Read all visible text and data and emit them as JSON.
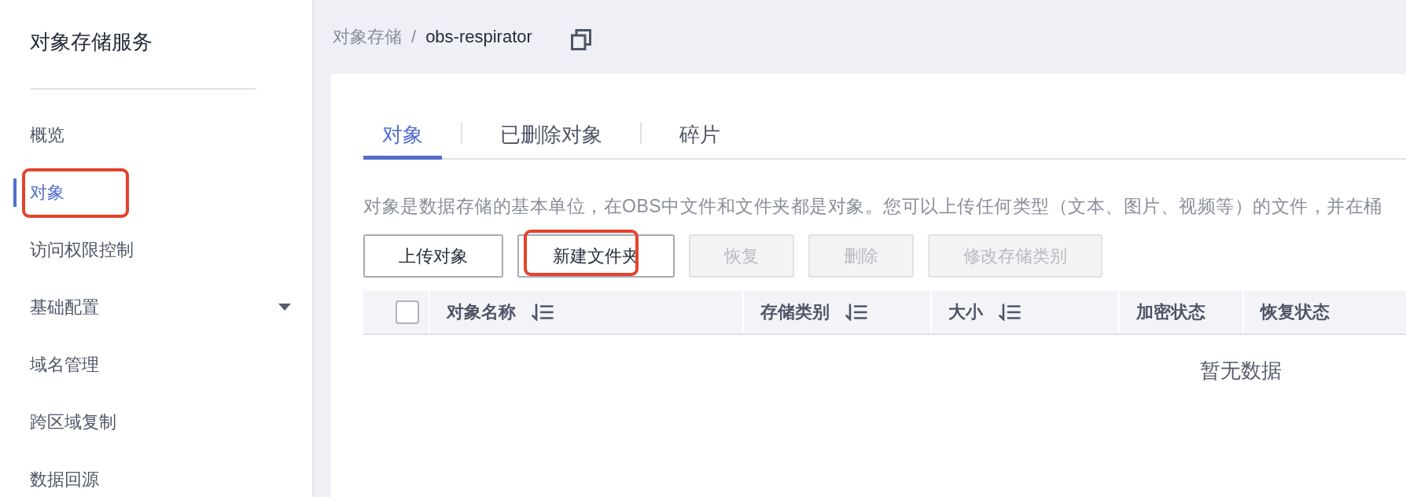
{
  "sidebar": {
    "title": "对象存储服务",
    "items": [
      {
        "label": "概览",
        "kind": "link",
        "selected": false,
        "annotated": false
      },
      {
        "label": "对象",
        "kind": "link",
        "selected": true,
        "annotated": true
      },
      {
        "label": "访问权限控制",
        "kind": "link",
        "selected": false,
        "annotated": false
      },
      {
        "label": "基础配置",
        "kind": "group",
        "selected": false,
        "annotated": false
      },
      {
        "label": "域名管理",
        "kind": "link",
        "selected": false,
        "annotated": false
      },
      {
        "label": "跨区域复制",
        "kind": "link",
        "selected": false,
        "annotated": false
      },
      {
        "label": "数据回源",
        "kind": "link",
        "selected": false,
        "annotated": false
      }
    ]
  },
  "breadcrumb": {
    "parent": "对象存储",
    "separator": "/",
    "current": "obs-respirator"
  },
  "tabs": [
    {
      "label": "对象",
      "selected": true
    },
    {
      "label": "已删除对象",
      "selected": false
    },
    {
      "label": "碎片",
      "selected": false
    }
  ],
  "description": "对象是数据存储的基本单位，在OBS中文件和文件夹都是对象。您可以上传任何类型（文本、图片、视频等）的文件，并在桶",
  "buttons": [
    {
      "label": "上传对象",
      "disabled": false,
      "annotated": false
    },
    {
      "label": "新建文件夹",
      "disabled": false,
      "annotated": true
    },
    {
      "label": "恢复",
      "disabled": true,
      "annotated": false
    },
    {
      "label": "删除",
      "disabled": true,
      "annotated": false
    },
    {
      "label": "修改存储类别",
      "disabled": true,
      "annotated": false
    }
  ],
  "table": {
    "select_all": {
      "checked": false
    },
    "columns": [
      {
        "label": "对象名称",
        "sortable": true
      },
      {
        "label": "存储类别",
        "sortable": true
      },
      {
        "label": "大小",
        "sortable": true
      },
      {
        "label": "加密状态",
        "sortable": false
      },
      {
        "label": "恢复状态",
        "sortable": false
      }
    ],
    "empty_text": "暂无数据"
  }
}
